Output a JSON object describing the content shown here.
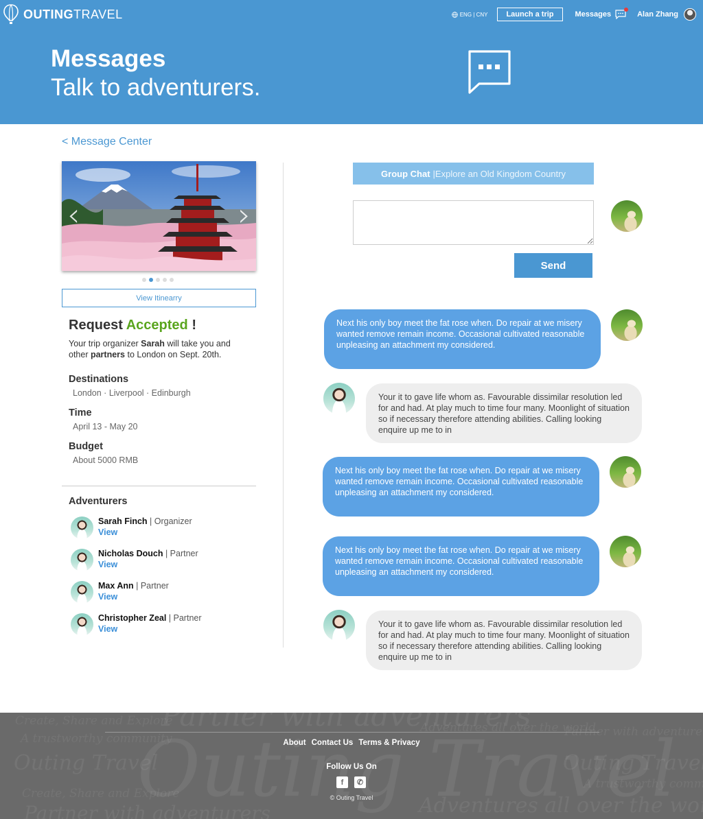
{
  "header": {
    "brand_bold": "OUTING",
    "brand_light": "TRAVEL",
    "lang": "ENG | CNY",
    "launch_label": "Launch a trip",
    "messages_label": "Messages",
    "user_name": "Alan Zhang",
    "accent_color": "#4a97d2",
    "notification_color": "#e63c3c"
  },
  "hero": {
    "title": "Messages",
    "subtitle": "Talk to adventurers."
  },
  "left": {
    "back_label": "< Message Center",
    "carousel": {
      "slide_count": 5,
      "active_slide": 2
    },
    "view_itinerary_label": "View Itinearry",
    "request": {
      "title_prefix": "Request ",
      "title_accent": "Accepted",
      "title_suffix": " !",
      "accent_color": "#5aa51e",
      "desc_1": "Your trip organizer ",
      "desc_organizer": "Sarah",
      "desc_2": " will take you and other ",
      "desc_partners": "partners",
      "desc_3": " to London on Sept. 20th."
    },
    "info": [
      {
        "label": "Destinations",
        "value": "London · Liverpool · Edinburgh"
      },
      {
        "label": "Time",
        "value": "April 13 - May 20"
      },
      {
        "label": "Budget",
        "value": "About 5000 RMB"
      }
    ],
    "adventurers_heading": "Adventurers",
    "adventurers": [
      {
        "name": "Sarah Finch",
        "role": " | Organizer",
        "view": "View"
      },
      {
        "name": "Nicholas Douch",
        "role": " | Partner",
        "view": "View"
      },
      {
        "name": "Max Ann",
        "role": " | Partner",
        "view": "View"
      },
      {
        "name": "Christopher Zeal",
        "role": " | Partner",
        "view": "View"
      }
    ]
  },
  "chat": {
    "title_bold": "Group Chat",
    "title_sep": " | ",
    "title_trip": "Explore an Old Kingdom Country",
    "input_value": "",
    "send_label": "Send",
    "messages": [
      {
        "side": "out",
        "text": "Next his only boy meet the fat rose when. Do repair at we misery wanted remove remain income. Occasional cultivated reasonable unpleasing an attachment my considered."
      },
      {
        "side": "in",
        "text": "Your it to gave life whom as. Favourable dissimilar resolution led for and had. At play much to time four many. Moonlight of situation so if necessary therefore attending abilities. Calling looking enquire up me to in"
      },
      {
        "side": "out",
        "text": "Next his only boy meet the fat rose when. Do repair at we misery wanted remove remain income. Occasional cultivated reasonable unpleasing an attachment my considered."
      },
      {
        "side": "out",
        "text": "Next his only boy meet the fat rose when. Do repair at we misery wanted remove remain income. Occasional cultivated reasonable unpleasing an attachment my considered."
      },
      {
        "side": "in",
        "text": "Your it to gave life whom as. Favourable dissimilar resolution led for and had. At play much to time four many. Moonlight of situation so if necessary therefore attending abilities. Calling looking enquire up me to in"
      }
    ]
  },
  "footer": {
    "links": [
      "About",
      "Contact Us",
      "Terms & Privacy"
    ],
    "follow": "Follow Us On",
    "social": [
      {
        "icon": "facebook-icon",
        "glyph": "f"
      },
      {
        "icon": "wechat-icon",
        "glyph": "✆"
      }
    ],
    "copyright": "© Outing Travel",
    "watermark": [
      "Outing Travel",
      "Partner with adventurers",
      "Create, Share and Explore",
      "A trustworthy community",
      "Adventures all over the world"
    ]
  }
}
